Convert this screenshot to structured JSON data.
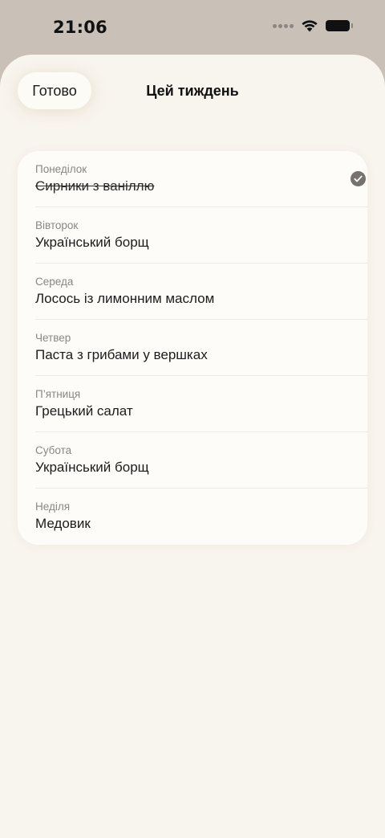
{
  "status_bar": {
    "time": "21:06"
  },
  "header": {
    "done_label": "Готово",
    "title": "Цей тиждень"
  },
  "days": [
    {
      "day": "Понеділок",
      "dish": "Сирники з ваніллю",
      "completed": true
    },
    {
      "day": "Вівторок",
      "dish": "Український борщ",
      "completed": false
    },
    {
      "day": "Середа",
      "dish": "Лосось із лимонним маслом",
      "completed": false
    },
    {
      "day": "Четвер",
      "dish": "Паста з грибами у вершках",
      "completed": false
    },
    {
      "day": "П’ятниця",
      "dish": "Грецький салат",
      "completed": false
    },
    {
      "day": "Субота",
      "dish": "Український борщ",
      "completed": false
    },
    {
      "day": "Неділя",
      "dish": "Медовик",
      "completed": false
    }
  ],
  "colors": {
    "sheet": "#f8f4ee",
    "card": "#fefcf8",
    "check": "#77726d"
  },
  "icons": {
    "completed": "checkmark-circle-icon",
    "wifi": "wifi-icon",
    "battery": "battery-icon"
  }
}
